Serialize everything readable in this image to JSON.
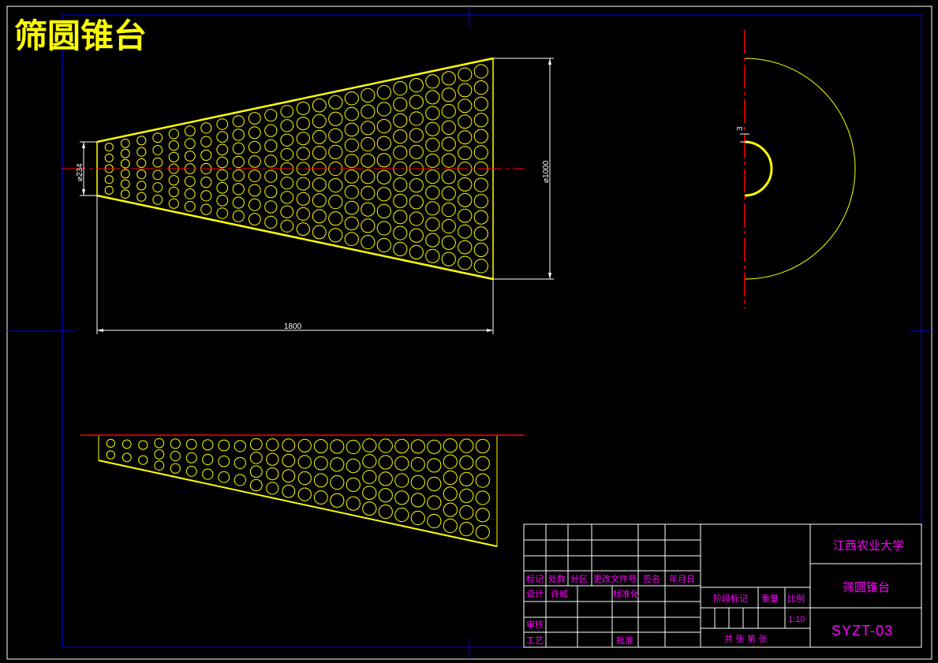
{
  "drawing_title": "筛圆锥台",
  "dimensions": {
    "small_diameter": "⌀234",
    "large_diameter": "⌀1000",
    "length": "1800",
    "thickness": "3"
  },
  "title_block": {
    "school": "江西农业大学",
    "part_name": "筛圆锥台",
    "drawing_code": "SYZT-03",
    "scale_value": "1:10",
    "labels": {
      "mark": "标记",
      "count": "处数",
      "zone": "分区",
      "change_doc": "更改文件号",
      "signature": "签名",
      "date": "年月日",
      "design": "设计",
      "designer": "许威",
      "standardize": "标准化",
      "stage_mark": "阶段标记",
      "weight": "重量",
      "scale": "比例",
      "review": "审核",
      "process": "工艺",
      "approve": "批准",
      "sheets": "共 张 第 张"
    }
  },
  "colors": {
    "background": "#000000",
    "border": "#0000ff",
    "geometry": "#ffff00",
    "centerline": "#ff0000",
    "dimension": "#ffffff",
    "title_block_text": "#ff00ff"
  }
}
